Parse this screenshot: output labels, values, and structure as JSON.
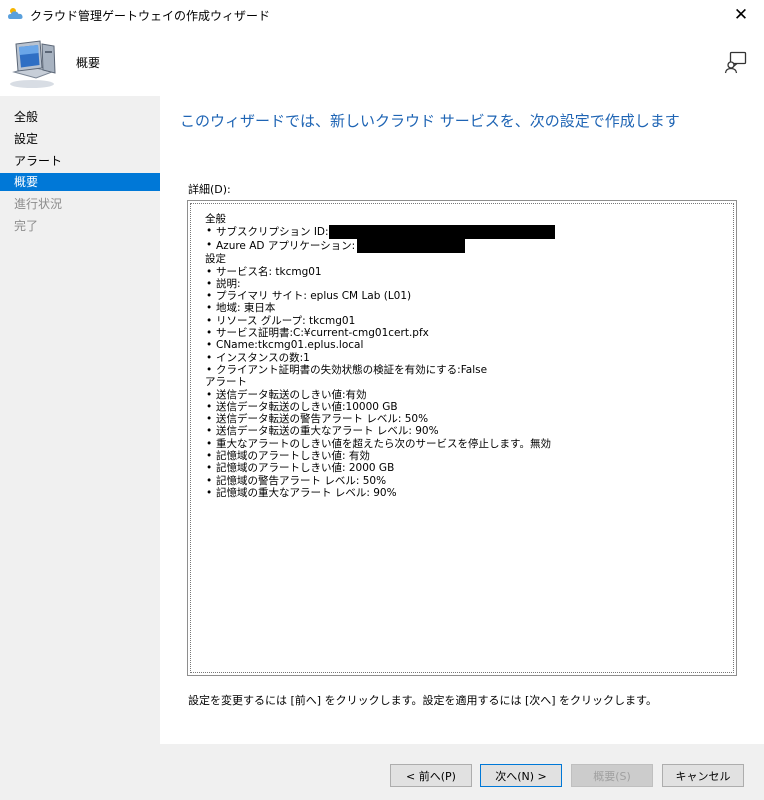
{
  "window": {
    "title": "クラウド管理ゲートウェイの作成ウィザード"
  },
  "header": {
    "page_name": "概要"
  },
  "sidebar": {
    "items": [
      {
        "label": "全般",
        "state": "normal"
      },
      {
        "label": "設定",
        "state": "normal"
      },
      {
        "label": "アラート",
        "state": "normal"
      },
      {
        "label": "概要",
        "state": "active"
      },
      {
        "label": "進行状況",
        "state": "disabled"
      },
      {
        "label": "完了",
        "state": "disabled"
      }
    ]
  },
  "main": {
    "heading": "このウィザードでは、新しいクラウド サービスを、次の設定で作成します",
    "details_label": "詳細(D):",
    "details": {
      "general": {
        "title": "全般",
        "subscription_id": "サブスクリプション ID:",
        "azure_ad_app": "Azure AD アプリケーション:"
      },
      "settings": {
        "title": "設定",
        "items": [
          "サービス名: tkcmg01",
          "説明:",
          "プライマリ サイト: eplus CM Lab (L01)",
          "地域: 東日本",
          "リソース グループ: tkcmg01",
          "サービス証明書:C:¥current-cmg01cert.pfx",
          "CName:tkcmg01.eplus.local",
          "インスタンスの数:1",
          "クライアント証明書の失効状態の検証を有効にする:False"
        ]
      },
      "alerts": {
        "title": "アラート",
        "items": [
          "送信データ転送のしきい値:有効",
          "送信データ転送のしきい値:10000 GB",
          "送信データ転送の警告アラート レベル: 50%",
          "送信データ転送の重大なアラート レベル: 90%",
          "重大なアラートのしきい値を超えたら次のサービスを停止します。無効",
          "記憶域のアラートしきい値: 有効",
          "記憶域のアラートしきい値: 2000 GB",
          "記憶域の警告アラート レベル: 50%",
          "記憶域の重大なアラート レベル: 90%"
        ]
      }
    },
    "instructions": "設定を変更するには [前へ] をクリックします。設定を適用するには [次へ] をクリックします。"
  },
  "footer": {
    "back_label": "< 前へ(P)",
    "next_label": "次へ(N) >",
    "summary_label": "概要(S)",
    "cancel_label": "キャンセル"
  },
  "colors": {
    "accent": "#0078d7",
    "heading": "#1e64b4",
    "panel": "#f0f0f0"
  },
  "icons": [
    "cloud-app-icon",
    "close-icon",
    "computer-icon",
    "help-icon"
  ]
}
